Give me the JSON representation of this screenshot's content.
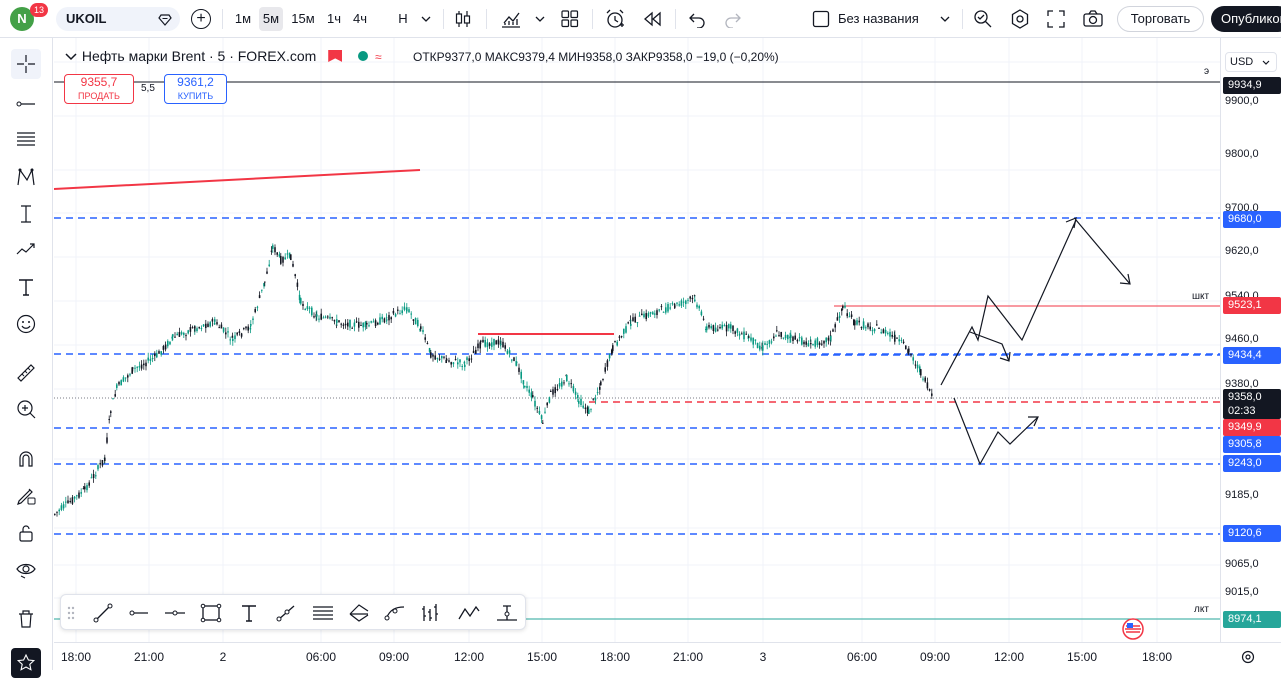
{
  "topbar": {
    "avatar_letter": "N",
    "notifications": "13",
    "symbol": "UKOIL",
    "intervals": [
      "1м",
      "5м",
      "15м",
      "1ч",
      "4ч",
      "Н"
    ],
    "active_interval": "5м",
    "layout_name": "Без названия",
    "trade_label": "Торговать",
    "publish_label": "Опубликовать"
  },
  "legend": {
    "title": "Нефть марки Brent · 5 · FOREX.com",
    "open_label": "ОТКР",
    "open": "9377,0",
    "high_label": "МАКС",
    "high": "9379,4",
    "low_label": "МИН",
    "low": "9358,0",
    "close_label": "ЗАКР",
    "close": "9358,0",
    "change": "−19,0 (−0,20%)"
  },
  "order": {
    "sell_price": "9355,7",
    "sell_label": "ПРОДАТЬ",
    "spread": "5,5",
    "buy_price": "9361,2",
    "buy_label": "КУПИТЬ"
  },
  "price_axis": {
    "currency": "USD",
    "labels": [
      "9900,0",
      "9800,0",
      "9700,0",
      "9620,0",
      "9540,0",
      "9460,0",
      "9380,0",
      "9185,0",
      "9065,0",
      "9015,0"
    ],
    "tags": {
      "t9934": "9934,9",
      "t9680": "9680,0",
      "t9523": "9523,1",
      "t9434": "9434,4",
      "t9358": "9358,0",
      "t_countdown": "02:33",
      "t9349": "9349,9",
      "t9305": "9305,8",
      "t9243": "9243,0",
      "t9120": "9120,6",
      "t8974": "8974,1"
    },
    "line_labels": {
      "top": "э",
      "shkt": "шкт",
      "lkt": "лкт"
    }
  },
  "time_axis": {
    "labels": [
      "18:00",
      "21:00",
      "2",
      "06:00",
      "09:00",
      "12:00",
      "15:00",
      "18:00",
      "21:00",
      "3",
      "06:00",
      "09:00",
      "12:00",
      "15:00",
      "18:00"
    ]
  },
  "colors": {
    "up": "#089981",
    "down": "#131722",
    "red": "#f23645",
    "blue": "#2962ff",
    "teal": "#26a69a",
    "black": "#131722"
  }
}
